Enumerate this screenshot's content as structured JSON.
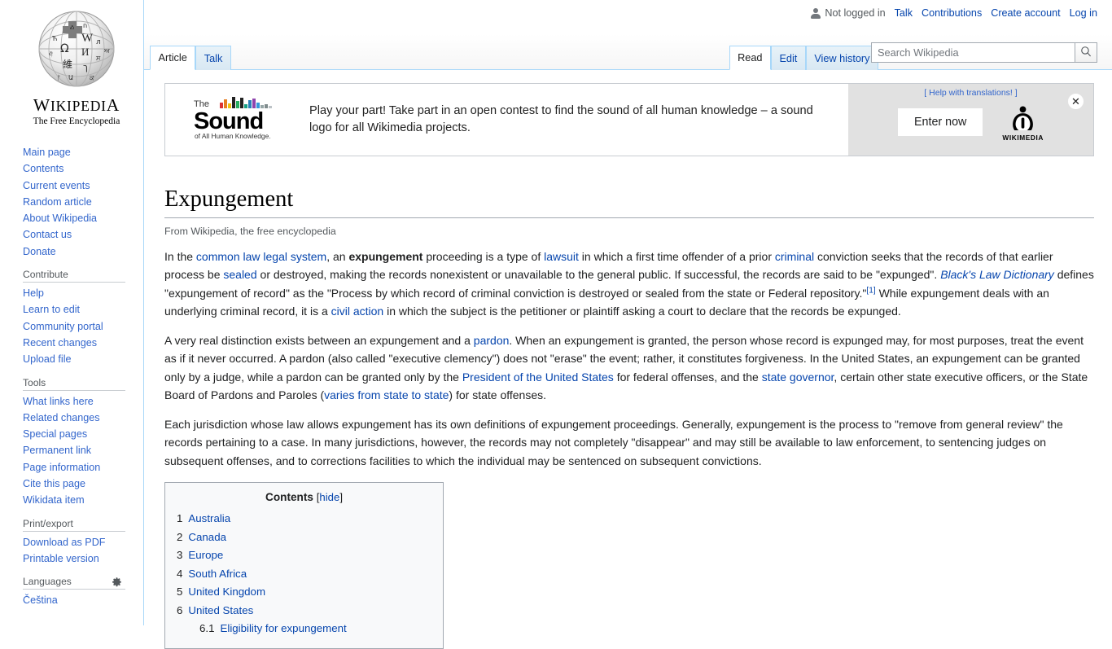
{
  "personal_bar": {
    "not_logged_in": "Not logged in",
    "user_icon": "user-icon",
    "links": [
      "Talk",
      "Contributions",
      "Create account",
      "Log in"
    ]
  },
  "logo": {
    "wordmark_upper": "W",
    "wordmark": "IKIPEDI",
    "wordmark_last": "A",
    "full_wordmark": "WIKIPEDIA",
    "tagline": "The Free Encyclopedia"
  },
  "sidebar": {
    "portals": [
      {
        "heading": "",
        "items": [
          "Main page",
          "Contents",
          "Current events",
          "Random article",
          "About Wikipedia",
          "Contact us",
          "Donate"
        ]
      },
      {
        "heading": "Contribute",
        "items": [
          "Help",
          "Learn to edit",
          "Community portal",
          "Recent changes",
          "Upload file"
        ]
      },
      {
        "heading": "Tools",
        "items": [
          "What links here",
          "Related changes",
          "Special pages",
          "Permanent link",
          "Page information",
          "Cite this page",
          "Wikidata item"
        ]
      },
      {
        "heading": "Print/export",
        "items": [
          "Download as PDF",
          "Printable version"
        ]
      },
      {
        "heading": "Languages",
        "has_gear": true,
        "gear_icon": "gear-icon",
        "items": [
          "Čeština"
        ]
      }
    ]
  },
  "tabs": {
    "namespace": [
      {
        "label": "Article",
        "selected": true
      },
      {
        "label": "Talk",
        "selected": false
      }
    ],
    "views": [
      {
        "label": "Read",
        "selected": true
      },
      {
        "label": "Edit",
        "selected": false
      },
      {
        "label": "View history",
        "selected": false
      }
    ]
  },
  "search": {
    "placeholder": "Search Wikipedia",
    "value": "",
    "button_icon": "search-icon"
  },
  "banner": {
    "logo_the": "The",
    "logo_main": "Sound",
    "logo_sub": "of All Human Knowledge.",
    "message": "Play your part! Take part in an open contest to find the sound of all human knowledge – a sound logo for all Wikimedia projects.",
    "help_translations": "Help with translations!",
    "bracket_open": "[",
    "bracket_close": "]",
    "enter_now": "Enter now",
    "wikimedia_label": "WIKIMEDIA",
    "wikimedia_icon": "wikimedia-logo-icon",
    "close_icon": "close-icon",
    "close_glyph": "✕"
  },
  "article": {
    "title": "Expungement",
    "site_sub": "From Wikipedia, the free encyclopedia",
    "paragraph1": {
      "t1": "In the ",
      "l1": "common law legal system",
      "t2": ", an ",
      "b1": "expungement",
      "t3": " proceeding is a type of ",
      "l2": "lawsuit",
      "t4": " in which a first time offender of a prior ",
      "l3": "criminal",
      "t5": " conviction seeks that the records of that earlier process be ",
      "l4": "sealed",
      "t6": " or destroyed, making the records nonexistent or unavailable to the general public. If successful, the records are said to be \"expunged\". ",
      "i1": "Black's Law Dictionary",
      "t7": " defines \"expungement of record\" as the \"Process by which record of criminal conviction is destroyed or sealed from the state or Federal repository.\"",
      "ref1": "[1]",
      "t8": " While expungement deals with an underlying criminal record, it is a ",
      "l5": "civil action",
      "t9": " in which the subject is the petitioner or plaintiff asking a court to declare that the records be expunged."
    },
    "paragraph2": {
      "t1": "A very real distinction exists between an expungement and a ",
      "l1": "pardon",
      "t2": ". When an expungement is granted, the person whose record is expunged may, for most purposes, treat the event as if it never occurred. A pardon (also called \"executive clemency\") does not \"erase\" the event; rather, it constitutes forgiveness. In the United States, an expungement can be granted only by a judge, while a pardon can be granted only by the ",
      "l2": "President of the United States",
      "t3": " for federal offenses, and the ",
      "l3": "state governor",
      "t4": ", certain other state executive officers, or the State Board of Pardons and Paroles (",
      "l4": "varies from state to state",
      "t5": ") for state offenses."
    },
    "paragraph3": "Each jurisdiction whose law allows expungement has its own definitions of expungement proceedings. Generally, expungement is the process to \"remove from general review\" the records pertaining to a case. In many jurisdictions, however, the records may not completely \"disappear\" and may still be available to law enforcement, to sentencing judges on subsequent offenses, and to corrections facilities to which the individual may be sentenced on subsequent convictions."
  },
  "toc": {
    "title": "Contents",
    "toggle": "hide",
    "bracket_open": "[",
    "bracket_close": "]",
    "entries": [
      {
        "num": "1",
        "label": "Australia",
        "level": 1
      },
      {
        "num": "2",
        "label": "Canada",
        "level": 1
      },
      {
        "num": "3",
        "label": "Europe",
        "level": 1
      },
      {
        "num": "4",
        "label": "South Africa",
        "level": 1
      },
      {
        "num": "5",
        "label": "United Kingdom",
        "level": 1
      },
      {
        "num": "6",
        "label": "United States",
        "level": 1
      },
      {
        "num": "6.1",
        "label": "Eligibility for expungement",
        "level": 2
      }
    ]
  },
  "colors": {
    "link": "#0645ad",
    "sidebar_link": "#3366cc",
    "tab_border": "#a7d7f9",
    "banner_side_bg": "#e1e1e1"
  }
}
